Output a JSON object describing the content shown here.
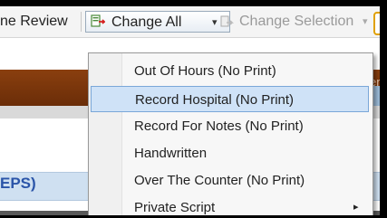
{
  "toolbar": {
    "review_label": "ne Review",
    "change_all_label": "Change All",
    "change_selection_label": "Change Selection",
    "dropdown_arrow": "▾"
  },
  "menu": {
    "items": [
      {
        "label": "Out Of Hours (No Print)"
      },
      {
        "label": "Record Hospital (No Print)"
      },
      {
        "label": "Record For Notes (No Print)"
      },
      {
        "label": "Handwritten"
      },
      {
        "label": "Over The Counter (No Print)"
      },
      {
        "label": "Private Script",
        "submenu_arrow": "▸"
      }
    ]
  },
  "background": {
    "blue_bar_text": "EPS)",
    "right_partial": "en"
  },
  "colors": {
    "highlight": "#cfe2f7",
    "brown_band": "#7a360c",
    "accent_blue": "#2a54a8"
  }
}
